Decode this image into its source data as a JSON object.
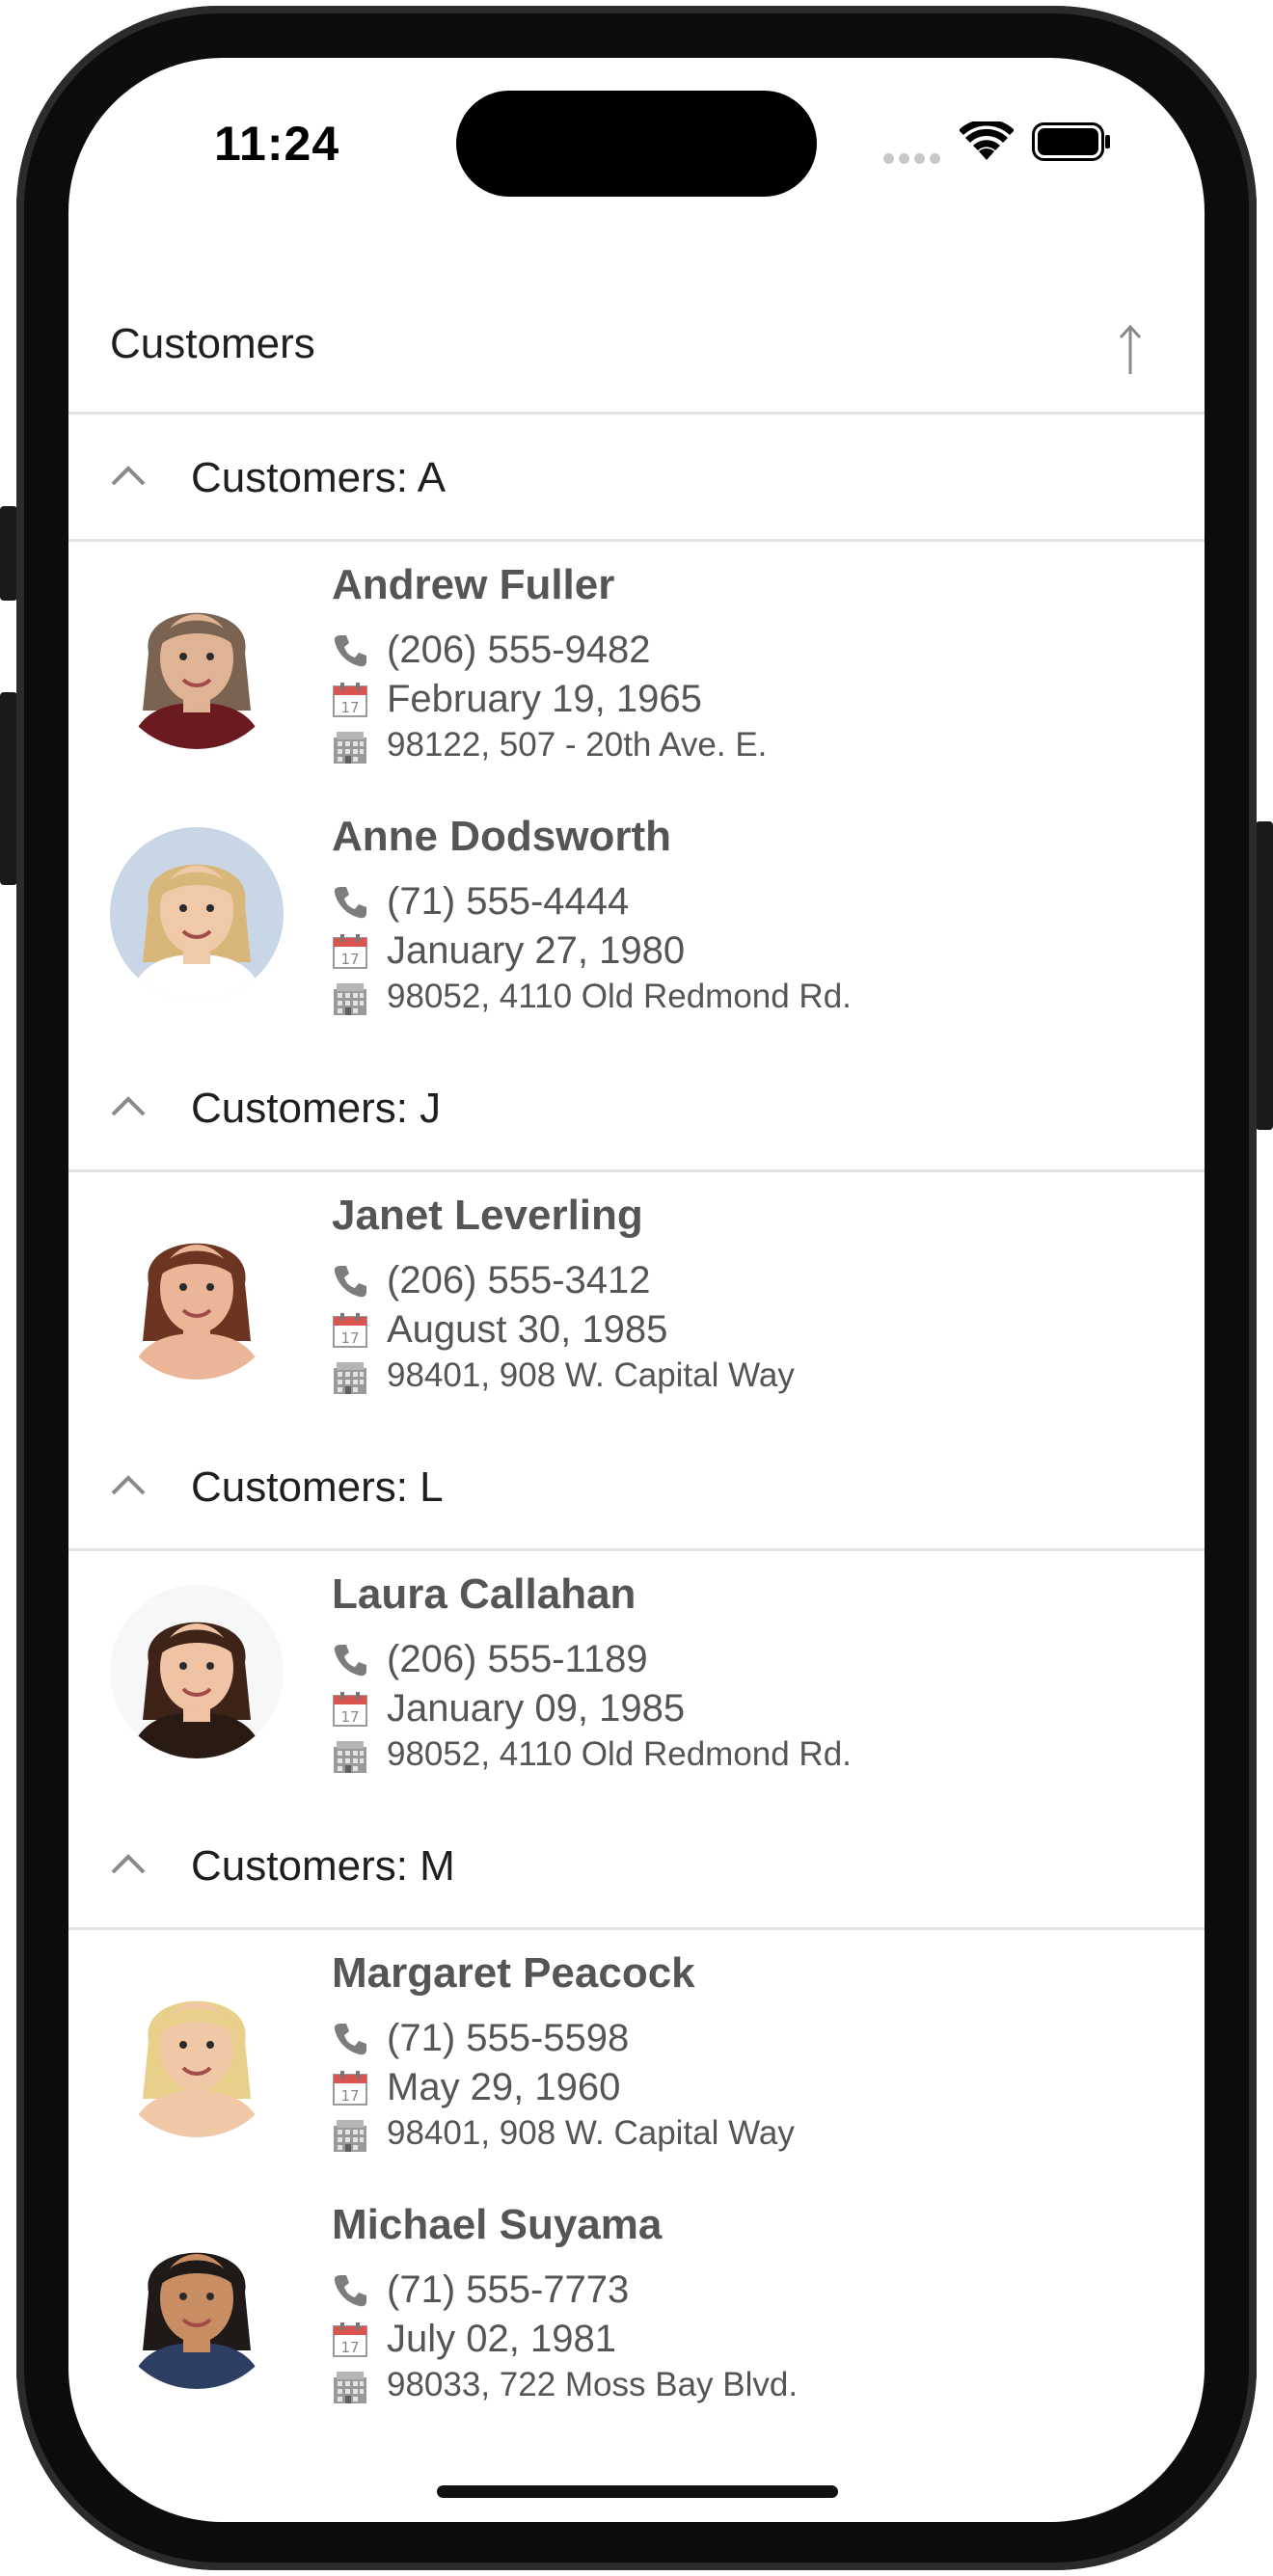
{
  "status_bar": {
    "time": "11:24"
  },
  "header": {
    "title": "Customers",
    "sort_icon": "arrow-up-icon"
  },
  "groups": [
    {
      "title": "Customers: A",
      "items": [
        {
          "name": "Andrew Fuller",
          "phone": "(206) 555-9482",
          "birthdate": "February 19, 1965",
          "address": "98122, 507 - 20th Ave. E.",
          "skin": "#e0b394",
          "hair": "#7a6350",
          "bg": "#ffffff",
          "shirt": "#6b1a1f"
        },
        {
          "name": "Anne Dodsworth",
          "phone": "(71) 555-4444",
          "birthdate": "January 27, 1980",
          "address": "98052, 4110 Old Redmond Rd.",
          "skin": "#f0c9a8",
          "hair": "#d9b77a",
          "bg": "#c9d6e6",
          "shirt": "#ffffff"
        }
      ]
    },
    {
      "title": "Customers: J",
      "items": [
        {
          "name": "Janet Leverling",
          "phone": "(206) 555-3412",
          "birthdate": "August 30, 1985",
          "address": "98401, 908 W. Capital Way",
          "skin": "#eab697",
          "hair": "#6b3522",
          "bg": "#ffffff",
          "shirt": "#eab697"
        }
      ]
    },
    {
      "title": "Customers: L",
      "items": [
        {
          "name": "Laura Callahan",
          "phone": "(206) 555-1189",
          "birthdate": "January 09, 1985",
          "address": "98052, 4110 Old Redmond Rd.",
          "skin": "#efc3a3",
          "hair": "#3d2318",
          "bg": "#f7f7f7",
          "shirt": "#2a1a14"
        }
      ]
    },
    {
      "title": "Customers: M",
      "items": [
        {
          "name": "Margaret Peacock",
          "phone": "(71) 555-5598",
          "birthdate": "May 29, 1960",
          "address": "98401, 908 W. Capital Way",
          "skin": "#f1c8a6",
          "hair": "#e8cf8a",
          "bg": "#ffffff",
          "shirt": "#f1c8a6"
        },
        {
          "name": "Michael Suyama",
          "phone": "(71) 555-7773",
          "birthdate": "July 02, 1981",
          "address": "98033, 722 Moss Bay Blvd.",
          "skin": "#c98d64",
          "hair": "#1f1a17",
          "bg": "#ffffff",
          "shirt": "#2d3e63"
        }
      ]
    }
  ],
  "icons": {
    "phone": "phone-icon",
    "calendar": "calendar-icon",
    "address": "building-icon",
    "collapse": "chevron-up-icon"
  },
  "colors": {
    "text_primary": "#1f1f1f",
    "text_secondary": "#555555",
    "divider": "#e3e3e3"
  }
}
